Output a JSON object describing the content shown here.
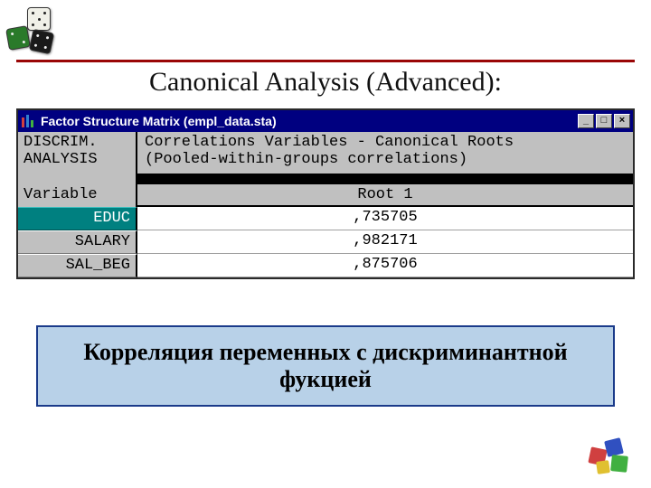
{
  "title": "Canonical Analysis (Advanced):",
  "window": {
    "title": "Factor Structure Matrix (empl_data.sta)",
    "header_left_line1": "DISCRIM.",
    "header_left_line2": "ANALYSIS",
    "header_right_line1": "Correlations Variables - Canonical Roots",
    "header_right_line2": "(Pooled-within-groups correlations)",
    "col_left_label": "Variable",
    "col_right_label": "Root 1",
    "rows": [
      {
        "var": "EDUC",
        "val": ",735705",
        "selected": true
      },
      {
        "var": "SALARY",
        "val": ",982171",
        "selected": false
      },
      {
        "var": "SAL_BEG",
        "val": ",875706",
        "selected": false
      }
    ],
    "btn_min": "_",
    "btn_max": "□",
    "btn_close": "×"
  },
  "caption": "Корреляция переменных с дискриминантной фукцией",
  "chart_data": {
    "type": "table",
    "title": "Factor Structure Matrix — Correlations Variables - Canonical Roots (Pooled-within-groups correlations)",
    "columns": [
      "Variable",
      "Root 1"
    ],
    "rows": [
      [
        "EDUC",
        0.735705
      ],
      [
        "SALARY",
        0.982171
      ],
      [
        "SAL_BEG",
        0.875706
      ]
    ]
  }
}
